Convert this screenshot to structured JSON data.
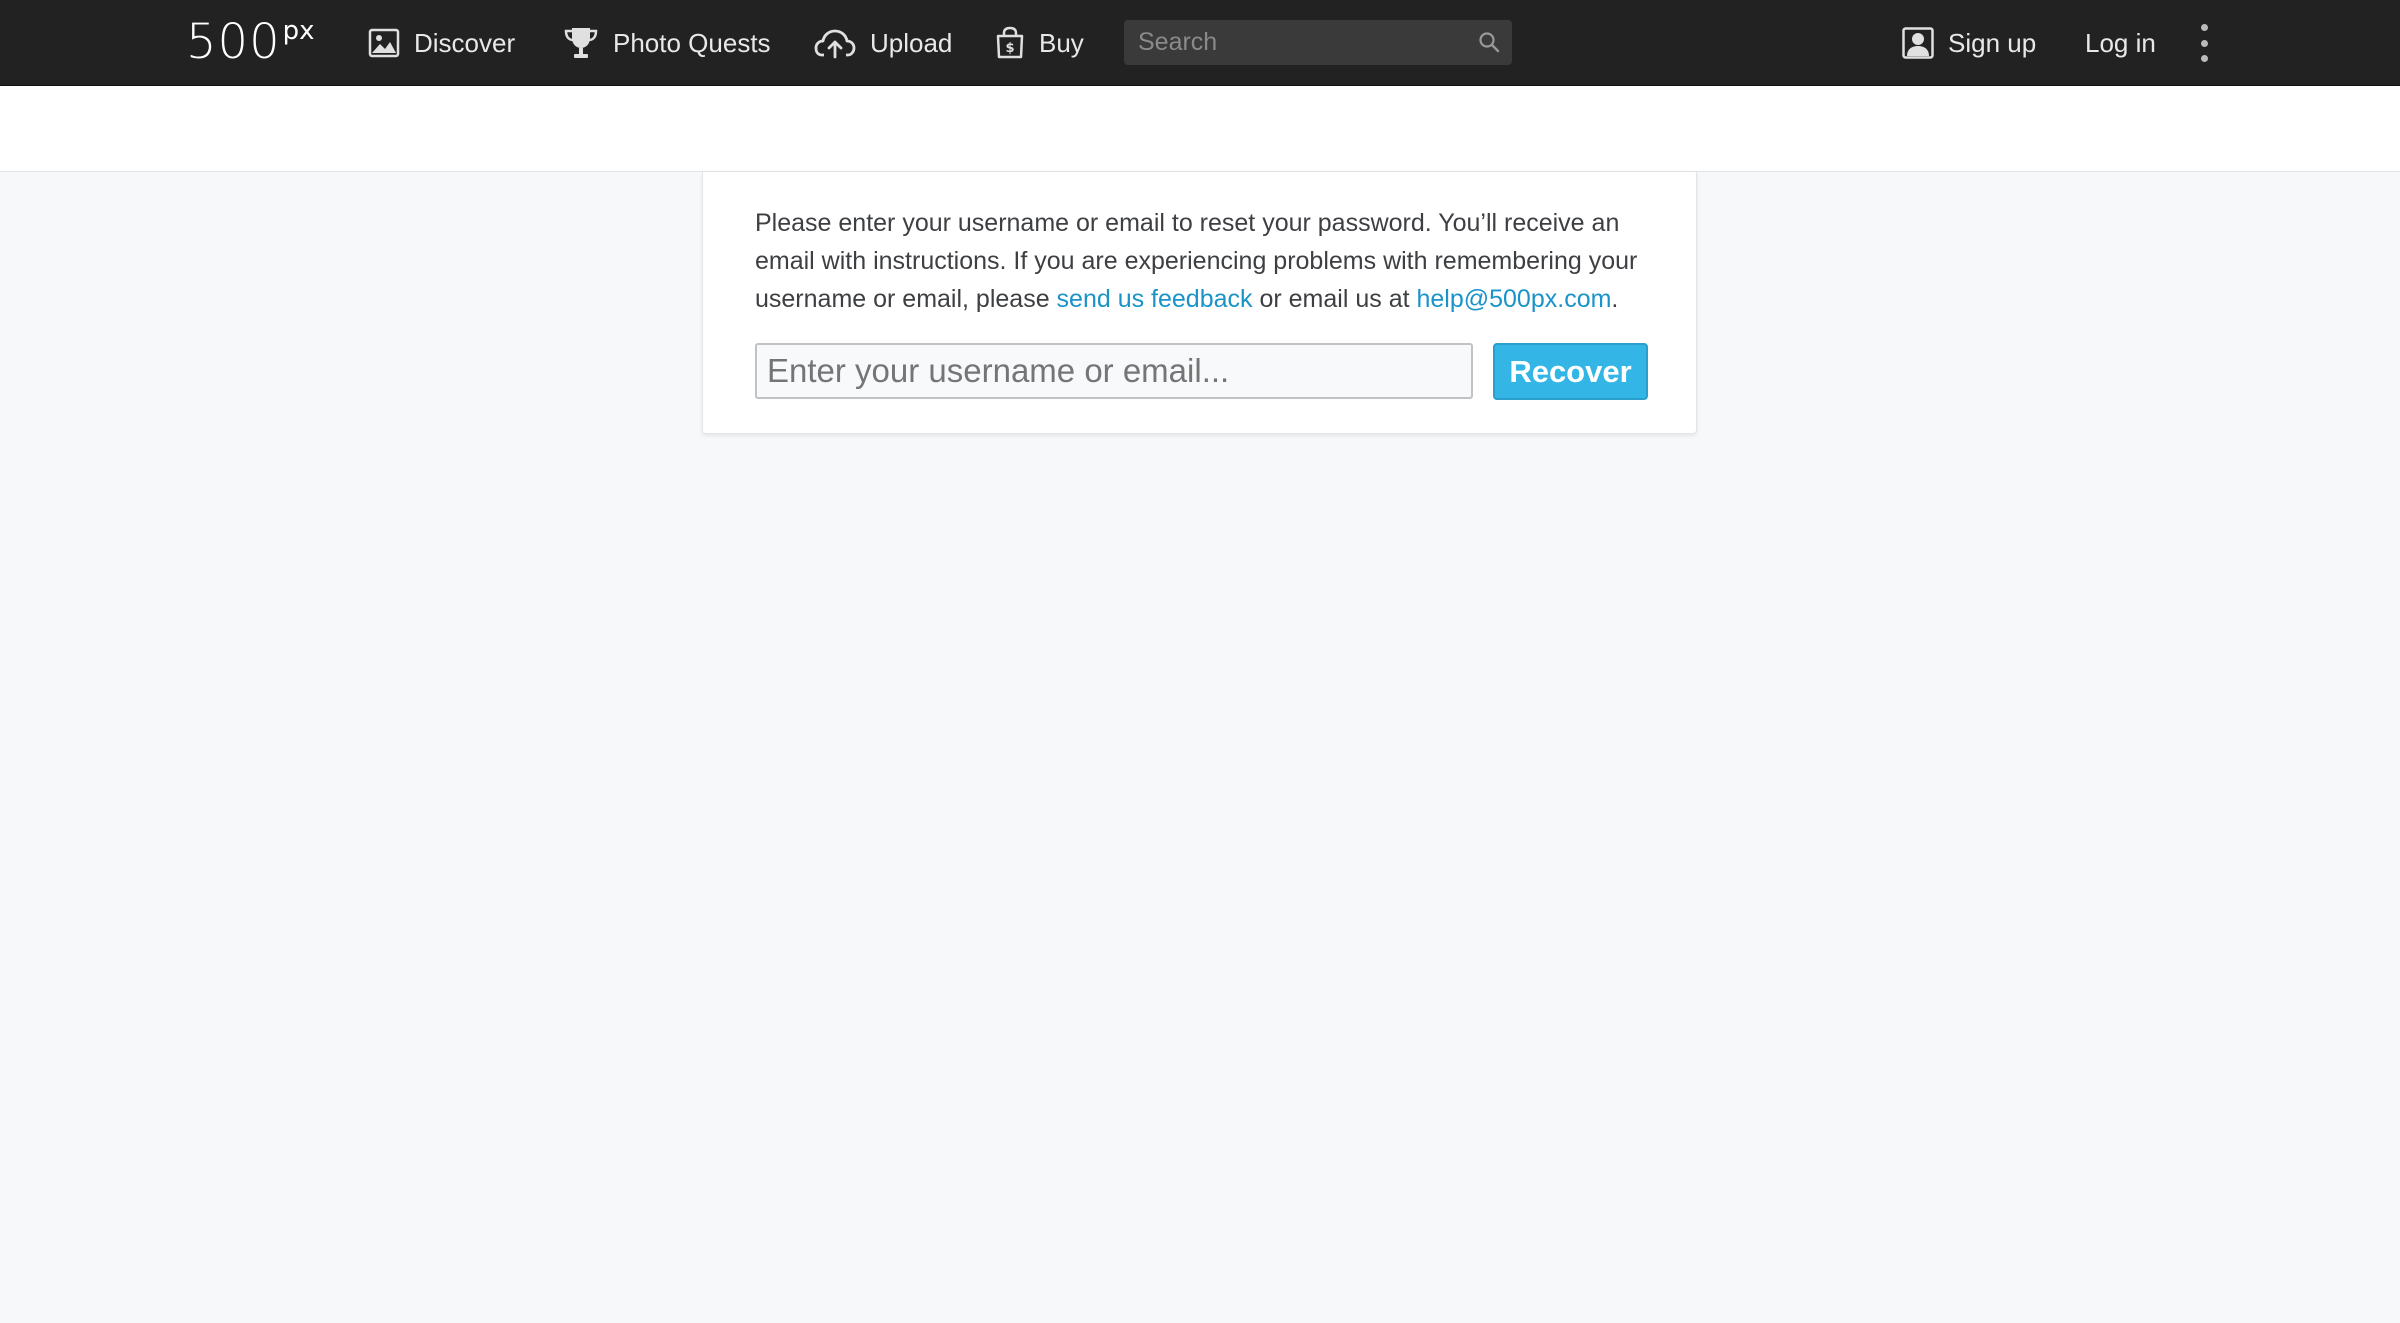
{
  "navbar": {
    "logo_main": "500",
    "logo_sup": "px",
    "items": [
      {
        "label": "Discover",
        "icon": "image-icon"
      },
      {
        "label": "Photo Quests",
        "icon": "trophy-icon"
      },
      {
        "label": "Upload",
        "icon": "cloud-upload-icon"
      },
      {
        "label": "Buy",
        "icon": "shopping-bag-icon"
      }
    ],
    "search": {
      "placeholder": "Search",
      "value": ""
    },
    "sign_up_label": "Sign up",
    "log_in_label": "Log in",
    "more_icon": "vertical-ellipsis-icon"
  },
  "recover": {
    "text_before": "Please enter your username or email to reset your password. You’ll receive an email with instructions. If you are experiencing problems with remembering your username or email, please ",
    "feedback_link": "send us feedback",
    "text_middle": " or email us at ",
    "email_link": "help@500px.com",
    "text_after": ".",
    "input_placeholder": "Enter your username or email...",
    "input_value": "",
    "button_label": "Recover"
  },
  "colors": {
    "navbar_bg": "#222222",
    "page_bg": "#f7f8fa",
    "link": "#1a93c9",
    "button_bg": "#33b6e6"
  }
}
